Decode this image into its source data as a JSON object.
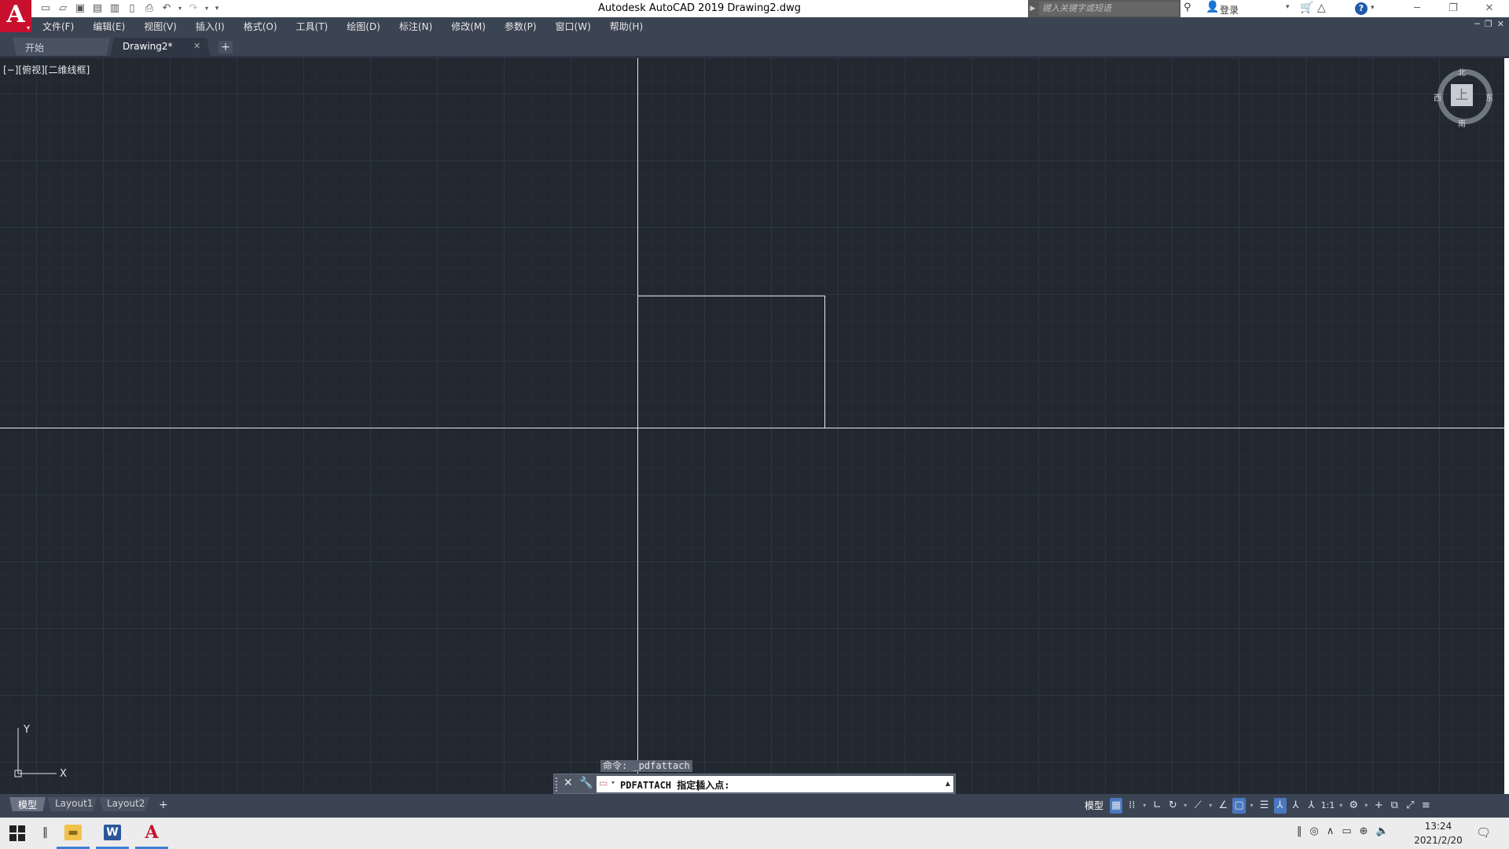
{
  "title_bar": {
    "app_title": "Autodesk AutoCAD 2019    Drawing2.dwg",
    "search_placeholder": "键入关键字或短语",
    "login_label": "登录"
  },
  "menu": {
    "items": [
      "文件(F)",
      "编辑(E)",
      "视图(V)",
      "插入(I)",
      "格式(O)",
      "工具(T)",
      "绘图(D)",
      "标注(N)",
      "修改(M)",
      "参数(P)",
      "窗口(W)",
      "帮助(H)"
    ]
  },
  "tabs": {
    "start": "开始",
    "drawing": "Drawing2*"
  },
  "viewport": {
    "label": "[−][俯视][二维线框]"
  },
  "viewcube": {
    "north": "北",
    "south": "南",
    "east": "东",
    "west": "西",
    "top_face": "上"
  },
  "ucs": {
    "x": "X",
    "y": "Y"
  },
  "command": {
    "history": "命令: _pdfattach",
    "prompt": "PDFATTACH 指定插入点:"
  },
  "layout_tabs": {
    "model": "模型",
    "layout1": "Layout1",
    "layout2": "Layout2"
  },
  "status_bar": {
    "model_label": "模型",
    "annotation_scale": "1:1"
  },
  "taskbar": {
    "time": "13:24",
    "date": "2021/2/20"
  },
  "colors": {
    "canvas": "#212830",
    "ui_chrome": "#3b4453",
    "brand_red": "#c8102e",
    "active_blue": "#4a78c0"
  }
}
